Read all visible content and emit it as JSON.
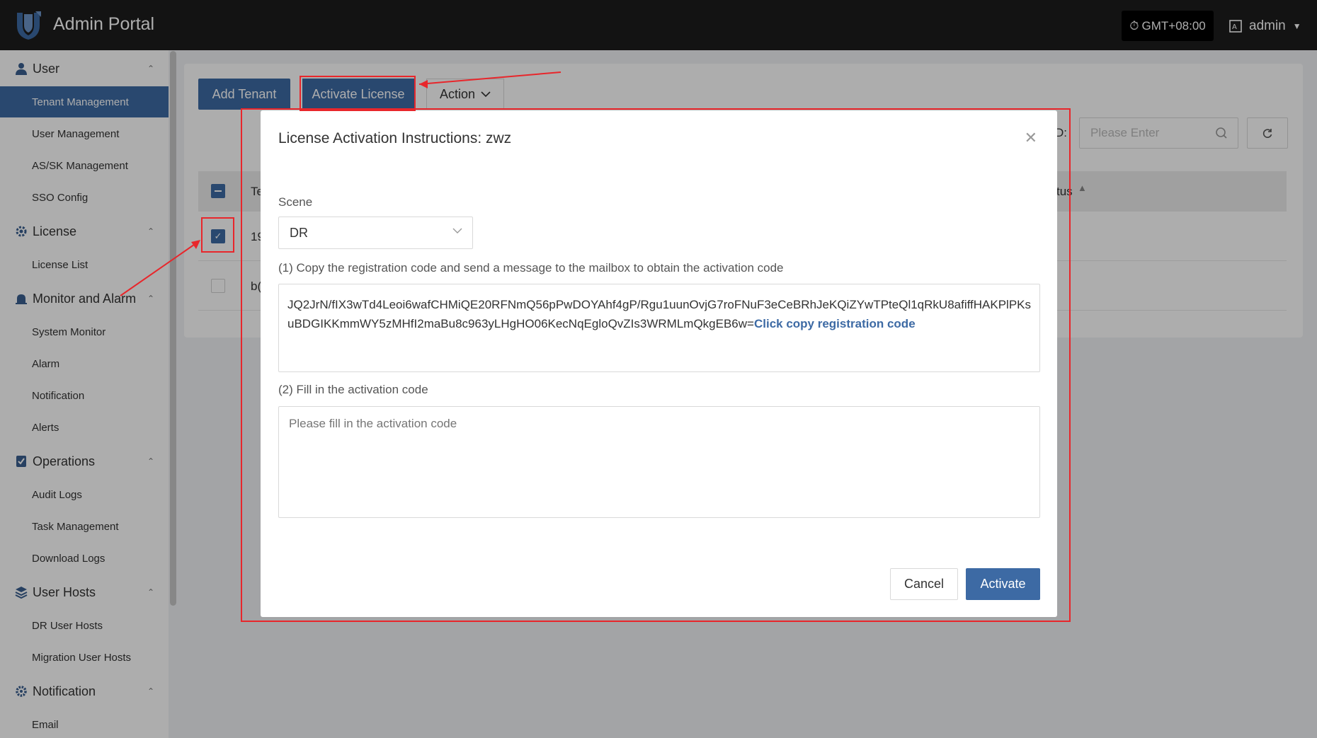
{
  "header": {
    "app_title": "Admin Portal",
    "timezone": "GMT+08:00",
    "user": "admin"
  },
  "sidebar": {
    "groups": [
      {
        "label": "User",
        "icon": "user-icon",
        "items": [
          "Tenant Management",
          "User Management",
          "AS/SK Management",
          "SSO Config"
        ]
      },
      {
        "label": "License",
        "icon": "license-icon",
        "items": [
          "License List"
        ]
      },
      {
        "label": "Monitor and Alarm",
        "icon": "monitor-icon",
        "items": [
          "System Monitor",
          "Alarm",
          "Notification",
          "Alerts"
        ]
      },
      {
        "label": "Operations",
        "icon": "operations-icon",
        "items": [
          "Audit Logs",
          "Task Management",
          "Download Logs"
        ]
      },
      {
        "label": "User Hosts",
        "icon": "layers-icon",
        "items": [
          "DR User Hosts",
          "Migration User Hosts"
        ]
      },
      {
        "label": "Notification",
        "icon": "gear-icon",
        "items": [
          "Email"
        ]
      }
    ],
    "active_item": "Tenant Management"
  },
  "toolbar": {
    "add_tenant": "Add Tenant",
    "activate_license": "Activate License",
    "action": "Action",
    "search_label": "D:",
    "search_placeholder": "Please Enter"
  },
  "table": {
    "header_col1": "Te",
    "header_status": "tus",
    "rows": [
      {
        "cell": "19",
        "checked": true
      },
      {
        "cell": "b(",
        "checked": false
      }
    ]
  },
  "modal": {
    "title": "License Activation Instructions: zwz",
    "scene_label": "Scene",
    "scene_value": "DR",
    "step1": "(1) Copy the registration code and send a message to the mailbox to obtain the activation code",
    "registration_code": "JQ2JrN/fIX3wTd4Leoi6wafCHMiQE20RFNmQ56pPwDOYAhf4gP/Rgu1uunOvjG7roFNuF3eCeBRhJeKQiZYwTPteQl1qRkU8afiffHAKPlPKsuBDGIKKmmWY5zMHfI2maBu8c963yLHgHO06KecNqEgloQvZIs3WRMLmQkgEB6w=",
    "copy_link": "Click copy registration code",
    "step2": "(2) Fill in the activation code",
    "activation_placeholder": "Please fill in the activation code",
    "cancel": "Cancel",
    "activate": "Activate"
  },
  "colors": {
    "primary": "#3d6aa4",
    "annotation": "#e8262b",
    "topbar": "#1c1c1c"
  }
}
